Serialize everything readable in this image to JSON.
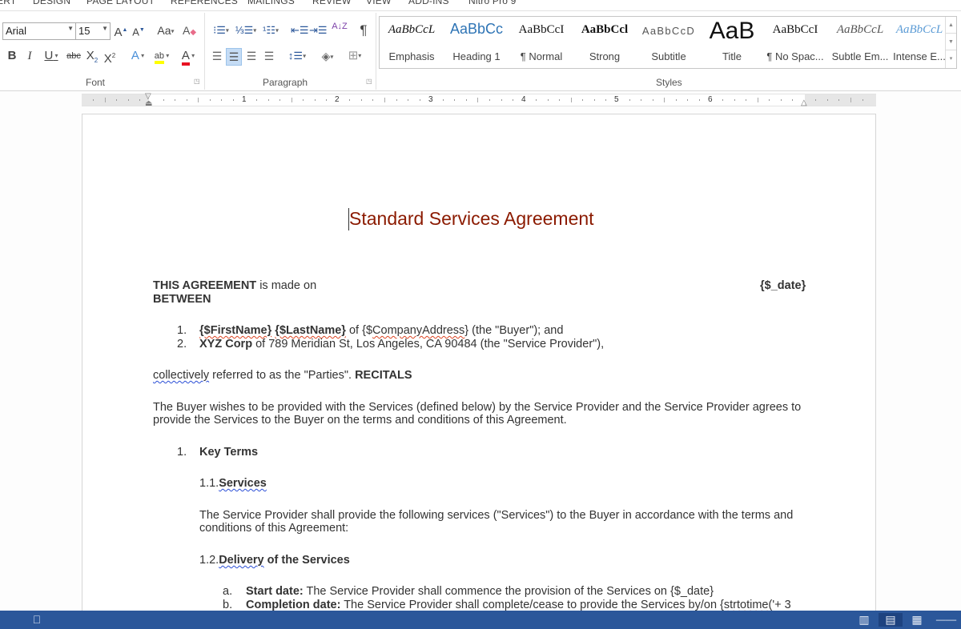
{
  "ribbon_tabs": [
    "ERT",
    "DESIGN",
    "PAGE LAYOUT",
    "REFERENCES",
    "MAILINGS",
    "REVIEW",
    "VIEW",
    "ADD-INS",
    "Nitro Pro 9"
  ],
  "font_group": {
    "label": "Font",
    "font_name": "Arial",
    "font_size": "15",
    "grow_font": "A",
    "shrink_font": "A",
    "change_case": "Aa",
    "bold": "B",
    "italic": "I",
    "underline": "U",
    "strikethrough": "abc",
    "subscript": "X",
    "superscript": "X",
    "text_effects": "A",
    "highlight": "ab",
    "font_color": "A",
    "highlight_color": "#ffff00",
    "font_color_value": "#e81123"
  },
  "paragraph_group": {
    "label": "Paragraph",
    "sort": "A↓Z",
    "pilcrow": "¶"
  },
  "styles_group": {
    "label": "Styles",
    "items": [
      {
        "sample": "AaBbCcL",
        "name": "Emphasis"
      },
      {
        "sample": "AaBbCc",
        "name": "Heading 1"
      },
      {
        "sample": "AaBbCcI",
        "name": "¶ Normal"
      },
      {
        "sample": "AaBbCcl",
        "name": "Strong"
      },
      {
        "sample": "AaBbCcD",
        "name": "Subtitle"
      },
      {
        "sample": "AaB",
        "name": "Title"
      },
      {
        "sample": "AaBbCcI",
        "name": "¶ No Spac..."
      },
      {
        "sample": "AaBbCcL",
        "name": "Subtle Em..."
      },
      {
        "sample": "AaBbCcL",
        "name": "Intense E..."
      }
    ]
  },
  "ruler": {
    "numbers": [
      "1",
      "2",
      "3",
      "4",
      "5",
      "6"
    ]
  },
  "document": {
    "title": "Standard Services Agreement",
    "agreement_bold": "THIS AGREEMENT",
    "agreement_rest": " is made on",
    "date_field": "{$_date}",
    "between": "BETWEEN",
    "parties": [
      {
        "num": "1.",
        "bold1": "{$FirstName}",
        "sp": " ",
        "bold2": "{$LastName}",
        "text1": " of {$",
        "field": "CompanyAddress",
        "text2": "} (the \"Buyer\"); and"
      },
      {
        "num": "2.",
        "bold": "XYZ Corp",
        "text": " of 789 Meridian St, Los Angeles, CA 90484 (the \"Service Provider\"),"
      }
    ],
    "collectively_word": "collectively",
    "collectively_rest": " referred to as the \"Parties\". ",
    "recitals": "RECITALS",
    "recitals_para_line1": "The Buyer wishes to be provided with the Services (defined below) by the Service Provider and the Service Provider agrees to",
    "recitals_para_line2": "provide the Services to the Buyer on the terms and conditions of this Agreement.",
    "section1_num": "1.",
    "section1_title": "Key Terms",
    "s11_num": "1.1.",
    "s11_title": "Services",
    "s11_para_line1": "The Service Provider shall provide the following services (\"Services\") to the Buyer in accordance with the terms and",
    "s11_para_line2": "conditions of this Agreement:",
    "s12_num": "1.2.",
    "s12_title_sq": "Delivery",
    "s12_title_rest": " of the Services",
    "items": [
      {
        "letter": "a.",
        "label": "Start date:",
        "text": " The Service Provider shall commence the provision of the Services on {$_date}"
      },
      {
        "letter": "b.",
        "label": "Completion date:",
        "text": " The Service Provider shall complete/cease to provide the Services by/on {",
        "sq": "strtotime",
        "tail": "('+ 3"
      }
    ]
  },
  "status_bar": {
    "views": [
      "read-mode",
      "print-layout",
      "web-layout"
    ],
    "active_view": "print-layout"
  }
}
